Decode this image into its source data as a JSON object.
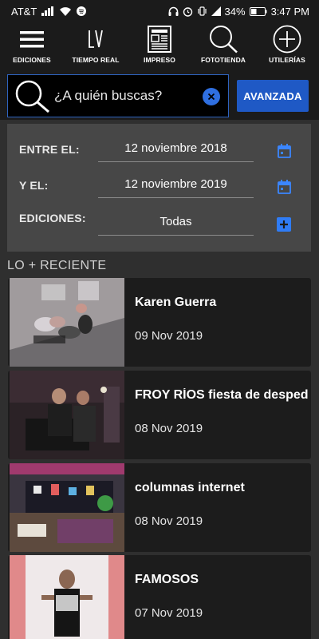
{
  "status_bar": {
    "carrier": "AT&T",
    "battery": "34%",
    "time": "3:47 PM"
  },
  "nav": {
    "items": [
      {
        "label": "EDICIONES",
        "icon": "hamburger-menu-icon"
      },
      {
        "label": "TIEMPO REAL",
        "icon": "lv-logo-icon"
      },
      {
        "label": "IMPRESO",
        "icon": "newspaper-icon"
      },
      {
        "label": "FOTOTIENDA",
        "icon": "search-icon"
      },
      {
        "label": "UTILERÍAS",
        "icon": "plus-circle-icon"
      }
    ]
  },
  "search": {
    "placeholder": "¿A quién buscas?",
    "advanced_label": "AVANZADA"
  },
  "filters": {
    "from_label": "ENTRE EL:",
    "from_value": "12 noviembre 2018",
    "to_label": "Y EL:",
    "to_value": "12 noviembre 2019",
    "editions_label": "EDICIONES:",
    "editions_value": "Todas"
  },
  "section_title": "LO + RECIENTE",
  "news": [
    {
      "title": "Karen Guerra",
      "date": "09 Nov 2019"
    },
    {
      "title": "FROY RÍOS fiesta de despedida",
      "date": "08 Nov 2019"
    },
    {
      "title": "columnas internet",
      "date": "08 Nov 2019"
    },
    {
      "title": "FAMOSOS",
      "date": "07 Nov 2019"
    }
  ],
  "colors": {
    "accent": "#1f59c5",
    "header_bg": "#1b1b1b",
    "page_bg": "#2f2f2f",
    "filter_bg": "#474747",
    "card_bg": "#1c1c1c"
  }
}
